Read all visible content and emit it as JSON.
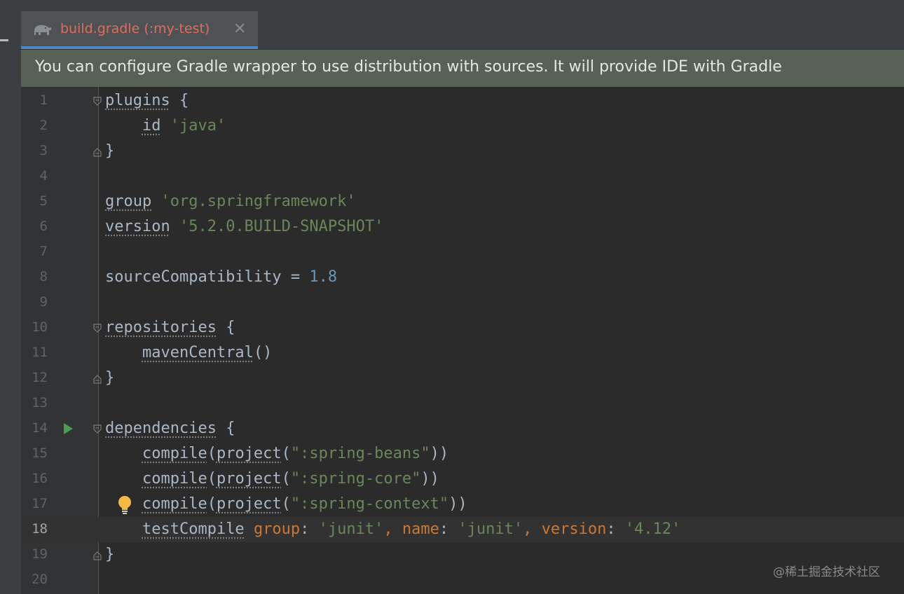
{
  "tab": {
    "label": "build.gradle (:my-test)",
    "close": "✕",
    "icon": "gradle-elephant-icon"
  },
  "banner": {
    "text": "You can configure Gradle wrapper to use distribution with sources. It will provide IDE with Gradle"
  },
  "lines": {
    "n1": "1",
    "n2": "2",
    "n3": "3",
    "n4": "4",
    "n5": "5",
    "n6": "6",
    "n7": "7",
    "n8": "8",
    "n9": "9",
    "n10": "10",
    "n11": "11",
    "n12": "12",
    "n13": "13",
    "n14": "14",
    "n15": "15",
    "n16": "16",
    "n17": "17",
    "n18": "18",
    "n19": "19",
    "n20": "20"
  },
  "code": {
    "l1_kw": "plugins",
    "l1_rest": " {",
    "l2_indent": "    ",
    "l2_kw": "id",
    "l2_sp": " ",
    "l2_str": "'java'",
    "l3": "}",
    "l5_kw": "group",
    "l5_sp": " ",
    "l5_str": "'org.springframework'",
    "l6_kw": "version",
    "l6_sp": " ",
    "l6_str": "'5.2.0.BUILD-SNAPSHOT'",
    "l8_id": "sourceCompatibility",
    "l8_eq": " = ",
    "l8_num": "1.8",
    "l10_kw": "repositories",
    "l10_rest": " {",
    "l11_indent": "    ",
    "l11_kw": "mavenCentral",
    "l11_rest": "()",
    "l12": "}",
    "l14_kw": "dependencies",
    "l14_rest": " {",
    "l15_indent": "    ",
    "l15_kw": "compile",
    "l15_p1": "(",
    "l15_kw2": "project",
    "l15_p2": "(",
    "l15_str": "\":spring-beans\"",
    "l15_p3": "))",
    "l16_indent": "    ",
    "l16_kw": "compile",
    "l16_p1": "(",
    "l16_kw2": "project",
    "l16_p2": "(",
    "l16_str": "\":spring-core\"",
    "l16_p3": "))",
    "l17_indent": "    ",
    "l17_kw": "compile",
    "l17_p1": "(",
    "l17_kw2": "project",
    "l17_p2": "(",
    "l17_str": "\":spring-context\"",
    "l17_p3": "))",
    "l18_indent": "    ",
    "l18_kw": "testCompile",
    "l18_sp": " ",
    "l18_n1": "group",
    "l18_c1": ": ",
    "l18_s1": "'junit'",
    "l18_cm1": ", ",
    "l18_n2": "name",
    "l18_c2": ": ",
    "l18_s2": "'junit'",
    "l18_cm2": ", ",
    "l18_n3": "version",
    "l18_c3": ": ",
    "l18_s3": "'4.12'",
    "l19": "}"
  },
  "watermark": "@稀土掘金技术社区",
  "colors": {
    "tab_label": "#e06c5e",
    "tab_underline": "#4a88c7",
    "banner_bg": "#576156",
    "editor_bg": "#2b2b2b",
    "string": "#6a8759",
    "number": "#6897bb",
    "named_arg": "#cc7832",
    "run_icon": "#499c54",
    "bulb": "#f4b942"
  }
}
